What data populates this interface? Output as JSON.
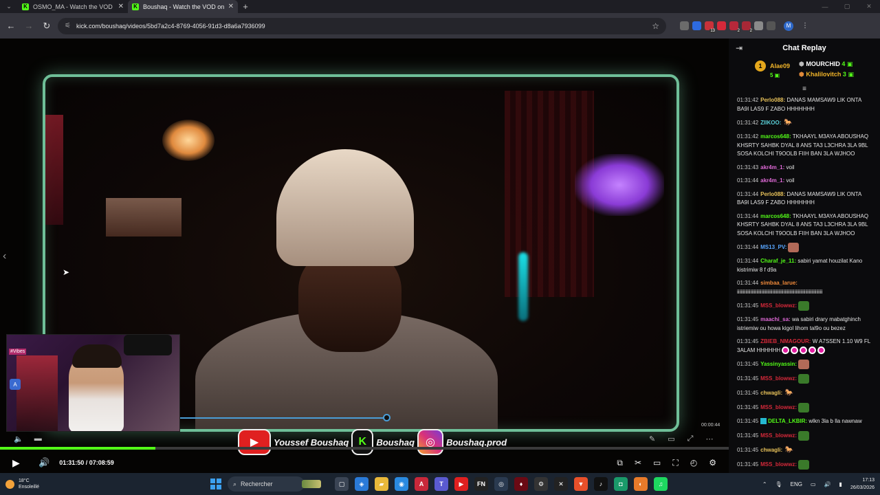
{
  "browser": {
    "tabs": [
      {
        "title": "OSMO_MA - Watch the VOD o",
        "favicon": "K",
        "active": false
      },
      {
        "title": "Boushaq - Watch the VOD on K",
        "favicon": "K",
        "active": true
      }
    ],
    "url": "kick.com/boushaq/videos/5bd7a2c4-8769-4056-91d3-d8a6a7936099",
    "extensions": [
      {
        "name": "ext-gray-icon",
        "color": "#6b6b6b"
      },
      {
        "name": "ext-blue-icon",
        "color": "#2d6be0"
      },
      {
        "name": "ext-red-badge-icon",
        "color": "#c8323a",
        "badge": "13"
      },
      {
        "name": "ext-red-icon",
        "color": "#d6293a"
      },
      {
        "name": "ext-red2-badge-icon",
        "color": "#b6283a",
        "badge": "2"
      },
      {
        "name": "ext-red3-icon",
        "color": "#a82836",
        "badge": "2"
      },
      {
        "name": "ext-gray2-icon",
        "color": "#8a8a8a"
      },
      {
        "name": "puzzle-icon",
        "color": "#555"
      }
    ],
    "profile_initial": "M"
  },
  "player": {
    "mini_time": "00:00:44",
    "timecode": "01:31:50 / 07:08:59",
    "progress_fraction": 0.213,
    "mini_progress_fraction": 0.53,
    "cam_tag": "#Vibes",
    "socials": [
      {
        "icon": "youtube-icon",
        "label": "Youssef Boushaq"
      },
      {
        "icon": "kick-icon",
        "label": "Boushaq"
      },
      {
        "icon": "instagram-icon",
        "label": "Boushaq.prod"
      }
    ]
  },
  "chat": {
    "title": "Chat Replay",
    "leaderboard": {
      "first": {
        "name": "Alae09",
        "count": "5"
      },
      "second": {
        "name": "MOURCHID",
        "count": "4"
      },
      "third": {
        "name": "Khalilovitch",
        "count": "3"
      }
    },
    "messages": [
      {
        "ts": "01:31:42",
        "user": "Perlo088:",
        "color": "#e8c25a",
        "text": " DANAS MAMSAW9 LIK ONTA BA9I LAS9 F ZABO HHHHHHH"
      },
      {
        "ts": "01:31:42",
        "user": "ZIIKOO:",
        "color": "#5ad0d8",
        "text": "",
        "emote": "gold"
      },
      {
        "ts": "01:31:42",
        "user": "marcos648:",
        "color": "#53fc18",
        "text": " TKHAAYL M3AYA ABOUSHAQ KHSRTY SAHBK DYAL 8 ANS TA3 L3CHRA 3LA 9BL SOSA KOLCHI T9OOLB FIIH BAN 3LA WJHOO"
      },
      {
        "ts": "01:31:43",
        "user": "akr4m_1:",
        "color": "#e06ad8",
        "text": " voil"
      },
      {
        "ts": "01:31:44",
        "user": "akr4m_1:",
        "color": "#e06ad8",
        "text": " voil"
      },
      {
        "ts": "01:31:44",
        "user": "Perlo088:",
        "color": "#e8c25a",
        "text": " DANAS MAMSAW9 LIK ONTA BA9I LAS9 F ZABO HHHHHHH"
      },
      {
        "ts": "01:31:44",
        "user": "marcos648:",
        "color": "#53fc18",
        "text": " TKHAAYL M3AYA ABOUSHAQ KHSRTY SAHBK DYAL 8 ANS TA3 L3CHRA 3LA 9BL SOSA KOLCHI T9OOLB FIIH BAN 3LA WJHOO"
      },
      {
        "ts": "01:31:44",
        "user": "MS13_PV:",
        "color": "#58a6ff",
        "text": "",
        "emote": "face"
      },
      {
        "ts": "01:31:44",
        "user": "Charaf_je_11:",
        "color": "#53fc18",
        "text": " sabiri yamat houzilat Kano kistrimiw 8 f d9a"
      },
      {
        "ts": "01:31:44",
        "user": "simbaa_larue:",
        "color": "#f08a3a",
        "text": " iiiiiiiiiiiiiiiiiiiiiiiiiiiiiiiiiiiiiiiiiiiiiiiiiiiiiiiiiiiiiiiiiiiiii"
      },
      {
        "ts": "01:31:45",
        "user": "MSS_blowwz:",
        "color": "#d6293a",
        "text": "",
        "emote": "frog"
      },
      {
        "ts": "01:31:45",
        "user": "maachi_sa:",
        "color": "#e06ad8",
        "text": " wa sabiri drary mabatghinch istriemiw ou howa kigol lihom tal9o ou bezez"
      },
      {
        "ts": "01:31:45",
        "user": "ZBIEB_NMAGOUR:",
        "color": "#d6293a",
        "text": " W A7SSEN 1.10 W9 FL 3ALAM HHHHHH",
        "dots": 5
      },
      {
        "ts": "01:31:45",
        "user": "Yassinyassin:",
        "color": "#53fc18",
        "text": "",
        "emote": "face"
      },
      {
        "ts": "01:31:45",
        "user": "MSS_blowwz:",
        "color": "#d6293a",
        "text": "",
        "emote": "frog"
      },
      {
        "ts": "01:31:45",
        "user": "chwagli:",
        "color": "#e8c25a",
        "text": "",
        "emote": "gold"
      },
      {
        "ts": "01:31:45",
        "user": "MSS_blowwz:",
        "color": "#d6293a",
        "text": "",
        "emote": "frog"
      },
      {
        "ts": "01:31:45",
        "user": "DELTA_LKBIR:",
        "color": "#53fc18",
        "text": " wlkn 3la b lla nawnaw",
        "badge": true
      },
      {
        "ts": "01:31:45",
        "user": "MSS_blowwz:",
        "color": "#d6293a",
        "text": "",
        "emote": "frog"
      },
      {
        "ts": "01:31:45",
        "user": "chwagli:",
        "color": "#e8c25a",
        "text": "",
        "emote": "gold"
      },
      {
        "ts": "01:31:45",
        "user": "MSS_blowwz:",
        "color": "#d6293a",
        "text": "",
        "emote": "frog"
      }
    ]
  },
  "taskbar": {
    "weather_temp": "18°C",
    "weather_desc": "Ensoleillé",
    "search_label": "Rechercher",
    "apps": [
      {
        "name": "task-view-icon",
        "color": "#3a4454",
        "glyph": "▢"
      },
      {
        "name": "copilot-icon",
        "color": "#2a7ad8",
        "glyph": "◈"
      },
      {
        "name": "file-explorer-icon",
        "color": "#e8b83a",
        "glyph": "▰"
      },
      {
        "name": "chrome-icon",
        "color": "#2a8ae0",
        "glyph": "◉"
      },
      {
        "name": "app-a-icon",
        "color": "#c8283a",
        "glyph": "A"
      },
      {
        "name": "teams-icon",
        "color": "#5a5ad0",
        "glyph": "T"
      },
      {
        "name": "youtube-app-icon",
        "color": "#e02020",
        "glyph": "▶"
      },
      {
        "name": "fn-app-icon",
        "color": "#222",
        "glyph": "FN"
      },
      {
        "name": "steam-icon",
        "color": "#2a3a50",
        "glyph": "◎"
      },
      {
        "name": "red-app-icon",
        "color": "#6a0a14",
        "glyph": "♦"
      },
      {
        "name": "settings-app-icon",
        "color": "#333",
        "glyph": "⚙"
      },
      {
        "name": "xbox-icon",
        "color": "#222",
        "glyph": "✕"
      },
      {
        "name": "brave-icon",
        "color": "#e8502a",
        "glyph": "▼"
      },
      {
        "name": "tiktok-icon",
        "color": "#111",
        "glyph": "♪"
      },
      {
        "name": "green-app-icon",
        "color": "#1a9a6a",
        "glyph": "◘"
      },
      {
        "name": "firefox-icon",
        "color": "#e87a2a",
        "glyph": "◐"
      },
      {
        "name": "spotify-icon",
        "color": "#1ed760",
        "glyph": "♫"
      }
    ],
    "language": "ENG",
    "time": "17:13",
    "date": "26/03/2026"
  }
}
